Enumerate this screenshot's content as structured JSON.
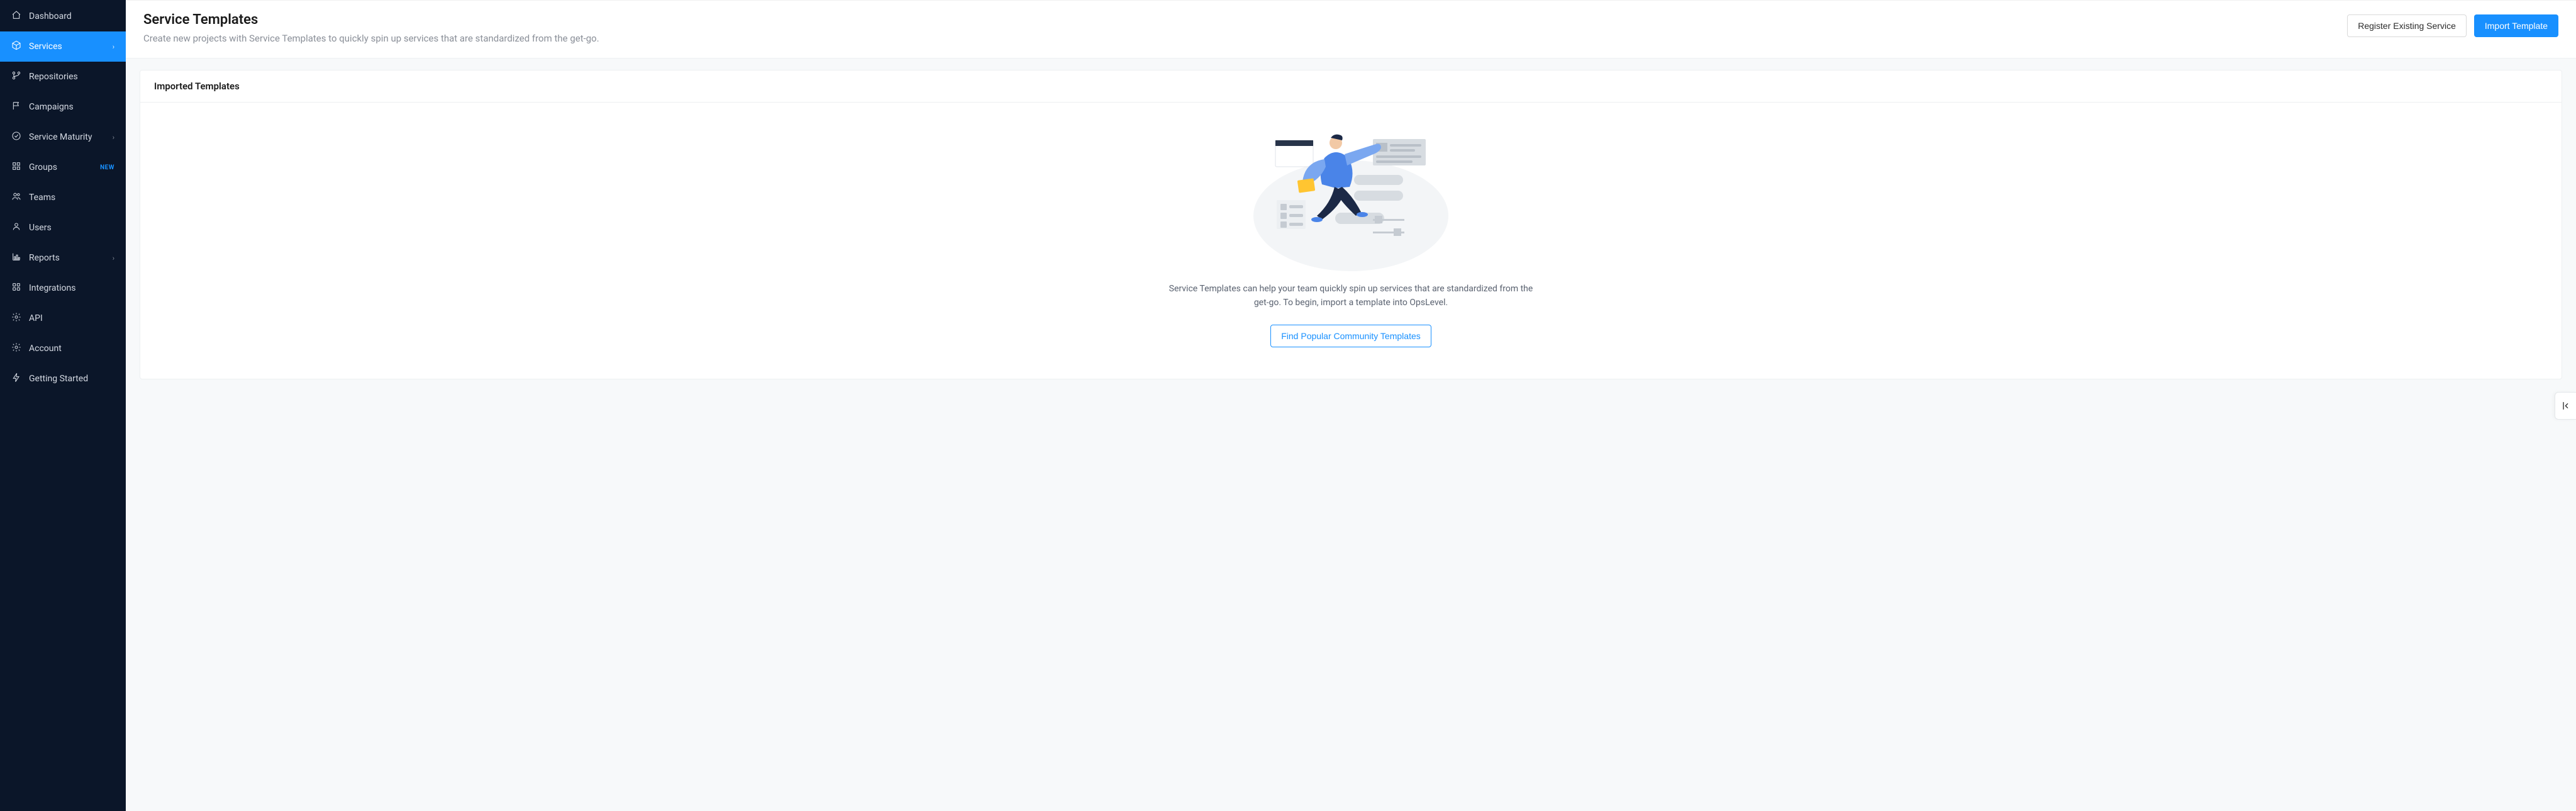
{
  "sidebar": {
    "items": [
      {
        "label": "Dashboard",
        "icon": "home",
        "active": false,
        "expandable": false
      },
      {
        "label": "Services",
        "icon": "cube",
        "active": true,
        "expandable": true
      },
      {
        "label": "Repositories",
        "icon": "branch",
        "active": false,
        "expandable": false
      },
      {
        "label": "Campaigns",
        "icon": "flag",
        "active": false,
        "expandable": false
      },
      {
        "label": "Service Maturity",
        "icon": "check-circle",
        "active": false,
        "expandable": true
      },
      {
        "label": "Groups",
        "icon": "grid",
        "active": false,
        "expandable": false,
        "badge": "NEW"
      },
      {
        "label": "Teams",
        "icon": "users",
        "active": false,
        "expandable": false
      },
      {
        "label": "Users",
        "icon": "user",
        "active": false,
        "expandable": false
      },
      {
        "label": "Reports",
        "icon": "chart",
        "active": false,
        "expandable": true
      },
      {
        "label": "Integrations",
        "icon": "apps",
        "active": false,
        "expandable": false
      },
      {
        "label": "API",
        "icon": "gear",
        "active": false,
        "expandable": false
      },
      {
        "label": "Account",
        "icon": "gear",
        "active": false,
        "expandable": false
      },
      {
        "label": "Getting Started",
        "icon": "bolt",
        "active": false,
        "expandable": false
      }
    ]
  },
  "header": {
    "title": "Service Templates",
    "subtitle": "Create new projects with Service Templates to quickly spin up services that are standardized from the get-go.",
    "register_label": "Register Existing Service",
    "import_label": "Import Template"
  },
  "card": {
    "title": "Imported Templates",
    "empty_text": "Service Templates can help your team quickly spin up services that are standardized from the get-go. To begin, import a template into OpsLevel.",
    "cta_label": "Find Popular Community Templates"
  }
}
